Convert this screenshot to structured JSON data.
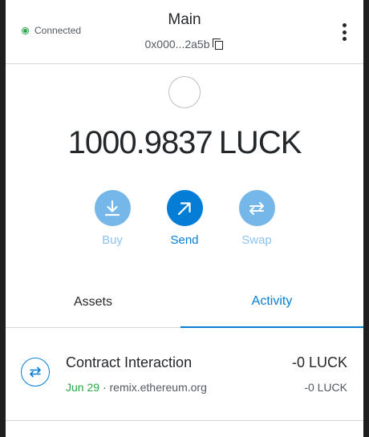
{
  "header": {
    "connection_status": "Connected",
    "account_name": "Main",
    "account_address": "0x000...2a5b"
  },
  "balance": {
    "amount": "1000.9837",
    "unit": "LUCK"
  },
  "actions": {
    "buy": "Buy",
    "send": "Send",
    "swap": "Swap"
  },
  "tabs": {
    "assets": "Assets",
    "activity": "Activity",
    "active": "Activity"
  },
  "activity": [
    {
      "title": "Contract Interaction",
      "date": "Jun 29",
      "separator": "·",
      "origin": "remix.ethereum.org",
      "amount": "-0 LUCK",
      "fiat": "-0 LUCK"
    }
  ],
  "colors": {
    "primary": "#037dd6",
    "primary_light": "#76b7e9",
    "connected": "#28a745",
    "text": "#24272a"
  },
  "icons": {
    "status": "status-dot-icon",
    "copy": "copy-icon",
    "menu": "kebab-menu-icon",
    "buy": "download-icon",
    "send": "arrow-up-right-icon",
    "swap": "swap-icon",
    "transaction": "swap-arrows-icon"
  }
}
